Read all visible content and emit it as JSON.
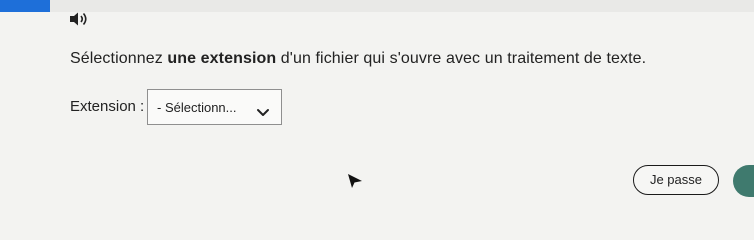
{
  "header": {
    "accent_color": "#1e6fd9",
    "audio_icon": "speaker-icon"
  },
  "question": {
    "prefix": "Sélectionnez ",
    "emphasis": "une extension",
    "suffix": " d'un fichier qui s'ouvre avec un traitement de texte."
  },
  "extension_field": {
    "label": "Extension :",
    "selected_value": "- Sélectionn...",
    "dropdown_icon": "chevron-down-icon"
  },
  "actions": {
    "skip_label": "Je passe",
    "next_button_color": "#3f7a6e"
  }
}
